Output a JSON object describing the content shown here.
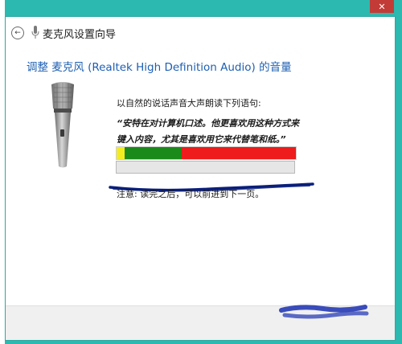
{
  "window": {
    "title": "麦克风设置向导",
    "close_glyph": "✕",
    "accent_color": "#2bb9b0"
  },
  "nav": {
    "back_glyph": "←"
  },
  "content": {
    "heading": "调整 麦克风 (Realtek High Definition Audio) 的音量",
    "instruction": "以自然的说话声音大声朗读下列语句:",
    "quote": "“安特在对计算机口述。他更喜欢用这种方式来键入内容，尤其是喜欢用它来代替笔和纸。”",
    "note": "注意: 读完之后，可以前进到下一页。"
  },
  "level_meter": {
    "segments": [
      "yellow",
      "green",
      "red"
    ],
    "colors": {
      "yellow": "#f3ec21",
      "green": "#1a8a1a",
      "red": "#ee1c1c"
    }
  },
  "progress": {
    "value": 0
  },
  "icons": {
    "back": "back-arrow-icon",
    "mic_small": "microphone-icon",
    "mic_large": "microphone-illustration-icon"
  }
}
